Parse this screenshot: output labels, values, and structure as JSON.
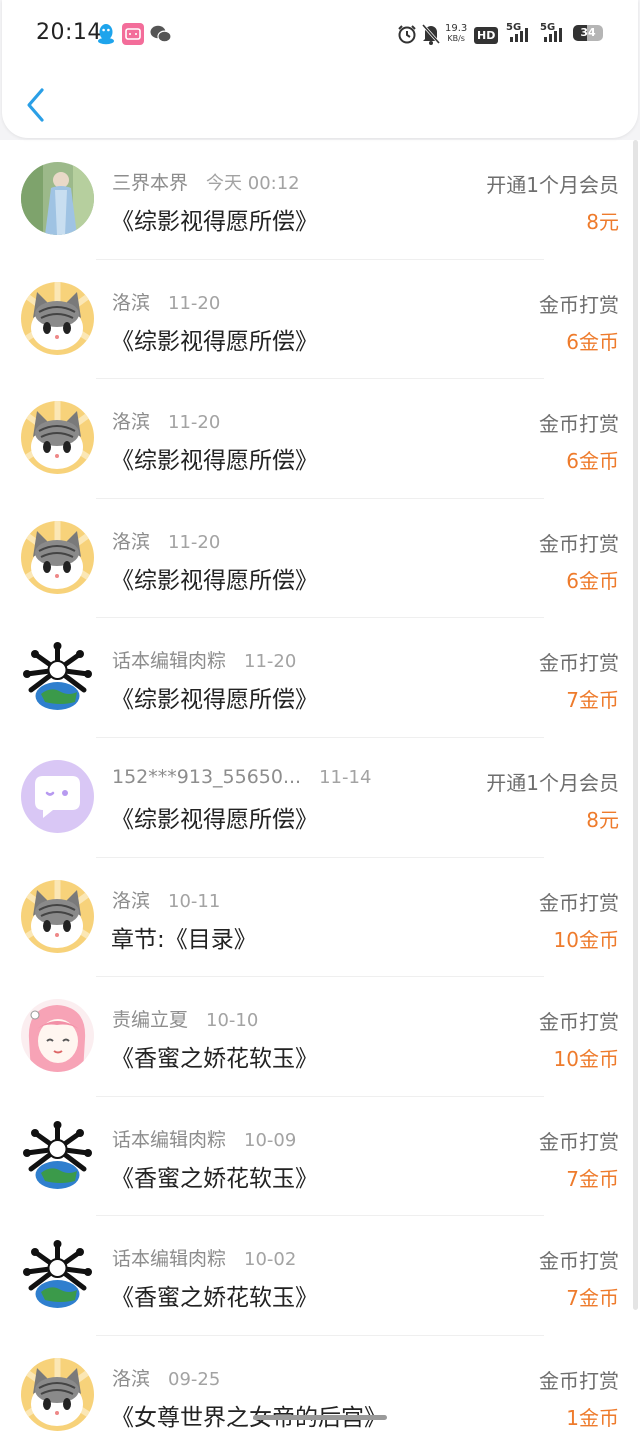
{
  "status_bar": {
    "time": "20:14",
    "net_speed_value": "19.3",
    "net_speed_unit": "KB/s",
    "hd_label": "HD",
    "sim1_label": "5G",
    "sim2_label": "5G",
    "battery": "34",
    "app_icons": [
      "qq-icon",
      "bilibili-icon",
      "wechat-icon"
    ]
  },
  "header": {
    "back_icon": "chevron-left-icon",
    "accent_color": "#2a9fe6"
  },
  "colors": {
    "amount": "#ee7b2c",
    "name": "#8d8d8d",
    "title": "#222222"
  },
  "records": [
    {
      "name": "三界本界",
      "date": "今天 00:12",
      "title": "《综影视得愿所偿》",
      "type": "开通1个月会员",
      "amount": "8元",
      "avatar": "portrait-avatar"
    },
    {
      "name": "洛滨",
      "date": "11-20",
      "title": "《综影视得愿所偿》",
      "type": "金币打赏",
      "amount": "6金币",
      "avatar": "cat-avatar"
    },
    {
      "name": "洛滨",
      "date": "11-20",
      "title": "《综影视得愿所偿》",
      "type": "金币打赏",
      "amount": "6金币",
      "avatar": "cat-avatar"
    },
    {
      "name": "洛滨",
      "date": "11-20",
      "title": "《综影视得愿所偿》",
      "type": "金币打赏",
      "amount": "6金币",
      "avatar": "cat-avatar"
    },
    {
      "name": "话本编辑肉粽",
      "date": "11-20",
      "title": "《综影视得愿所偿》",
      "type": "金币打赏",
      "amount": "7金币",
      "avatar": "globe-avatar"
    },
    {
      "name": "152***913_55650...",
      "date": "11-14",
      "title": "《综影视得愿所偿》",
      "type": "开通1个月会员",
      "amount": "8元",
      "avatar": "chat-bubble-avatar"
    },
    {
      "name": "洛滨",
      "date": "10-11",
      "title": "章节:《目录》",
      "type": "金币打赏",
      "amount": "10金币",
      "avatar": "cat-avatar"
    },
    {
      "name": "责编立夏",
      "date": "10-10",
      "title": "《香蜜之娇花软玉》",
      "type": "金币打赏",
      "amount": "10金币",
      "avatar": "anime-girl-avatar"
    },
    {
      "name": "话本编辑肉粽",
      "date": "10-09",
      "title": "《香蜜之娇花软玉》",
      "type": "金币打赏",
      "amount": "7金币",
      "avatar": "globe-avatar"
    },
    {
      "name": "话本编辑肉粽",
      "date": "10-02",
      "title": "《香蜜之娇花软玉》",
      "type": "金币打赏",
      "amount": "7金币",
      "avatar": "globe-avatar"
    },
    {
      "name": "洛滨",
      "date": "09-25",
      "title": "《女尊世界之女帝的后宫》",
      "type": "金币打赏",
      "amount": "1金币",
      "avatar": "cat-avatar"
    }
  ]
}
